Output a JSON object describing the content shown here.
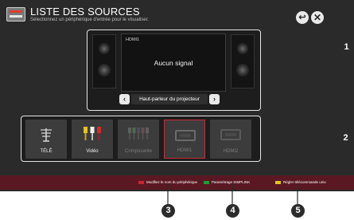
{
  "header": {
    "title": "LISTE DES SOURCES",
    "subtitle": "Sélectionnez un périphérique d'entrée pour le visualiser.",
    "back_icon": "↩",
    "close_icon": "✕"
  },
  "preview": {
    "input_name": "HDMI1",
    "status": "Aucun signal",
    "speaker_label": "Haut-parleur du projecteur",
    "prev_icon": "‹",
    "next_icon": "›"
  },
  "sources": [
    {
      "label": "TÉLÉ",
      "icon": "antenna-icon",
      "enabled": true
    },
    {
      "label": "Vidéo",
      "icon": "rca-icon",
      "enabled": true
    },
    {
      "label": "Composante",
      "icon": "component-icon",
      "enabled": false
    },
    {
      "label": "HDMI1",
      "icon": "hdmi-icon",
      "enabled": false,
      "selected": true
    },
    {
      "label": "HDMI2",
      "icon": "hdmi-icon",
      "enabled": false
    }
  ],
  "hints": [
    {
      "label": "Modifiez le nom du périphérique",
      "color": "#d2232a"
    },
    {
      "label": "Paramétrage SIMPLINK",
      "color": "#1f9b3a"
    },
    {
      "label": "Régler télécommande univ.",
      "color": "#e0c41c"
    }
  ],
  "callouts": [
    "1",
    "2",
    "3",
    "4",
    "5"
  ],
  "colors": {
    "background": "#2a2a2a",
    "bottom_bar": "#5a1822",
    "selected_border": "#c8293a"
  }
}
